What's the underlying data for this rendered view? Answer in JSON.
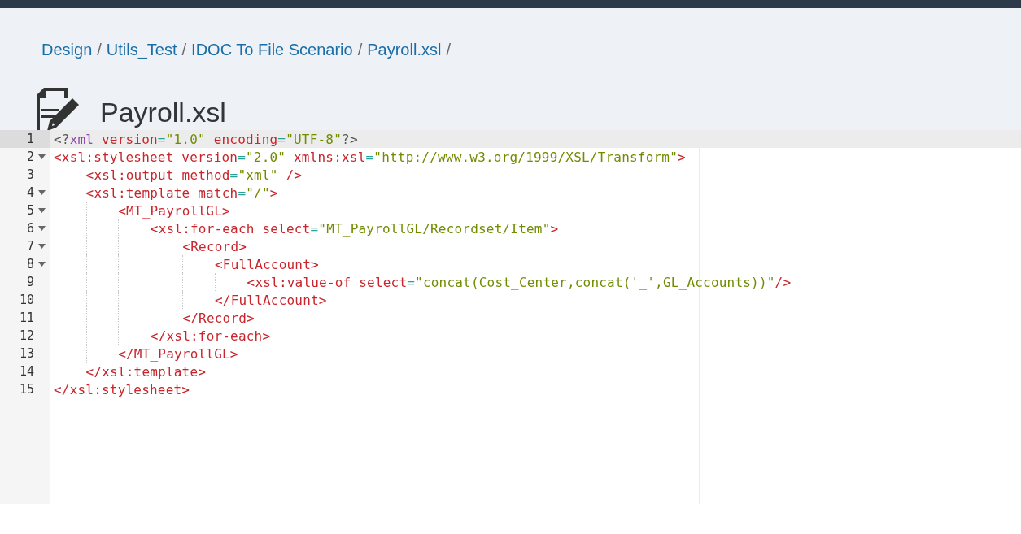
{
  "breadcrumb": [
    {
      "label": "Design"
    },
    {
      "label": "Utils_Test"
    },
    {
      "label": "IDOC To File Scenario"
    },
    {
      "label": "Payroll.xsl"
    }
  ],
  "breadcrumb_separators": [
    "/",
    "/",
    "/",
    "/"
  ],
  "title": "Payroll.xsl",
  "editor": {
    "lines": [
      {
        "number": "1",
        "active": true,
        "tokens": [
          {
            "kind": "punct",
            "text": "<?"
          },
          {
            "kind": "keyword",
            "text": "xml"
          },
          {
            "kind": "attr",
            "text": " version"
          },
          {
            "kind": "eq",
            "text": "="
          },
          {
            "kind": "str",
            "text": "\"1.0\""
          },
          {
            "kind": "attr",
            "text": " encoding"
          },
          {
            "kind": "eq",
            "text": "="
          },
          {
            "kind": "str",
            "text": "\"UTF-8\""
          },
          {
            "kind": "punct",
            "text": "?>"
          }
        ]
      },
      {
        "number": "2",
        "active": false,
        "tokens": [
          {
            "kind": "tag",
            "text": "<xsl:stylesheet"
          },
          {
            "kind": "attr",
            "text": " version"
          },
          {
            "kind": "eq",
            "text": "="
          },
          {
            "kind": "str",
            "text": "\"2.0\""
          },
          {
            "kind": "attr",
            "text": " xmlns:xsl"
          },
          {
            "kind": "eq",
            "text": "="
          },
          {
            "kind": "str",
            "text": "\"http://www.w3.org/1999/XSL/Transform\""
          },
          {
            "kind": "tag",
            "text": ">"
          }
        ],
        "children": [
          {
            "number": "3",
            "active": false,
            "tokens": [
              {
                "kind": "tag",
                "text": "<xsl:output"
              },
              {
                "kind": "attr",
                "text": " method"
              },
              {
                "kind": "eq",
                "text": "="
              },
              {
                "kind": "str",
                "text": "\"xml\""
              },
              {
                "kind": "tag",
                "text": " />"
              }
            ]
          },
          {
            "number": "4",
            "active": false,
            "tokens": [
              {
                "kind": "tag",
                "text": "<xsl:template"
              },
              {
                "kind": "attr",
                "text": " match"
              },
              {
                "kind": "eq",
                "text": "="
              },
              {
                "kind": "str",
                "text": "\"/\""
              },
              {
                "kind": "tag",
                "text": ">"
              }
            ],
            "children": [
              {
                "number": "5",
                "active": false,
                "tokens": [
                  {
                    "kind": "tag",
                    "text": "<MT_PayrollGL>"
                  }
                ],
                "children": [
                  {
                    "number": "6",
                    "active": false,
                    "tokens": [
                      {
                        "kind": "tag",
                        "text": "<xsl:for-each"
                      },
                      {
                        "kind": "attr",
                        "text": " select"
                      },
                      {
                        "kind": "eq",
                        "text": "="
                      },
                      {
                        "kind": "str",
                        "text": "\"MT_PayrollGL/Recordset/Item\""
                      },
                      {
                        "kind": "tag",
                        "text": ">"
                      }
                    ],
                    "children": [
                      {
                        "number": "7",
                        "active": false,
                        "tokens": [
                          {
                            "kind": "tag",
                            "text": "<Record>"
                          }
                        ],
                        "children": [
                          {
                            "number": "8",
                            "active": false,
                            "tokens": [
                              {
                                "kind": "tag",
                                "text": "<FullAccount>"
                              }
                            ],
                            "children": [
                              {
                                "number": "9",
                                "active": false,
                                "tokens": [
                                  {
                                    "kind": "tag",
                                    "text": "<xsl:value-of"
                                  },
                                  {
                                    "kind": "attr",
                                    "text": " select"
                                  },
                                  {
                                    "kind": "eq",
                                    "text": "="
                                  },
                                  {
                                    "kind": "str",
                                    "text": "\"concat(Cost_Center,concat('_',GL_Accounts))\""
                                  },
                                  {
                                    "kind": "tag",
                                    "text": "/>"
                                  }
                                ]
                              }
                            ]
                          },
                          {
                            "number": "10",
                            "active": false,
                            "tokens": [
                              {
                                "kind": "tag",
                                "text": "</FullAccount>"
                              }
                            ]
                          }
                        ]
                      },
                      {
                        "number": "11",
                        "active": false,
                        "tokens": [
                          {
                            "kind": "tag",
                            "text": "</Record>"
                          }
                        ]
                      }
                    ]
                  },
                  {
                    "number": "12",
                    "active": false,
                    "tokens": [
                      {
                        "kind": "tag",
                        "text": "</xsl:for-each>"
                      }
                    ]
                  }
                ]
              },
              {
                "number": "13",
                "active": false,
                "tokens": [
                  {
                    "kind": "tag",
                    "text": "</MT_PayrollGL>"
                  }
                ]
              }
            ]
          },
          {
            "number": "14",
            "active": false,
            "tokens": [
              {
                "kind": "tag",
                "text": "</xsl:template>"
              }
            ]
          }
        ]
      },
      {
        "number": "15",
        "active": false,
        "tokens": [
          {
            "kind": "tag",
            "text": "</xsl:stylesheet>"
          }
        ]
      }
    ]
  }
}
